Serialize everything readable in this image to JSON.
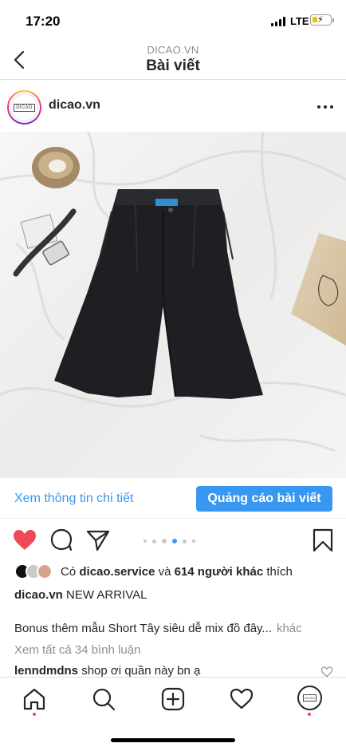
{
  "status_bar": {
    "time": "17:20",
    "network": "LTE",
    "icons": [
      "signal-icon",
      "battery-charging-icon"
    ]
  },
  "nav": {
    "subtitle": "DICAO.VN",
    "title": "Bài viết",
    "back_icon": "chevron-left-icon"
  },
  "post": {
    "avatar_logo_text": "DICAO",
    "username": "dicao.vn",
    "more_icon": "ellipsis-icon",
    "image": {
      "subject": "black pleated high-waist shorts",
      "props": [
        "woven-basket",
        "wristwatch",
        "kraft-card"
      ]
    }
  },
  "cta": {
    "details_link": "Xem thông tin chi tiết",
    "promote_button": "Quảng cáo bài viết"
  },
  "actions": {
    "like_icon": "heart-filled-icon",
    "comment_icon": "comment-icon",
    "share_icon": "paper-plane-icon",
    "bookmark_icon": "bookmark-icon",
    "carousel": {
      "total": 6,
      "active": 4
    }
  },
  "likes": {
    "prefix": "Có",
    "first_user": "dicao.service",
    "middle": "và",
    "others": "614 người khác",
    "suffix": "thích"
  },
  "caption": {
    "username": "dicao.vn",
    "text": "NEW ARRIVAL"
  },
  "bonus": {
    "text": "Bonus thêm mẫu Short Tây siêu dễ mix đồ đây...",
    "more": "khác"
  },
  "view_comments": "Xem tất cả 34 bình luận",
  "comment": {
    "username": "lenndmdns",
    "text": "shop ơi quần này bn ạ"
  },
  "tabbar": {
    "items": [
      "home-icon",
      "search-icon",
      "add-post-icon",
      "activity-heart-icon",
      "profile-avatar"
    ],
    "profile_logo_text": "DICAO"
  },
  "colors": {
    "accent": "#3897f0",
    "like_red": "#ed4956",
    "text": "#262626",
    "muted": "#8e8e8e"
  }
}
